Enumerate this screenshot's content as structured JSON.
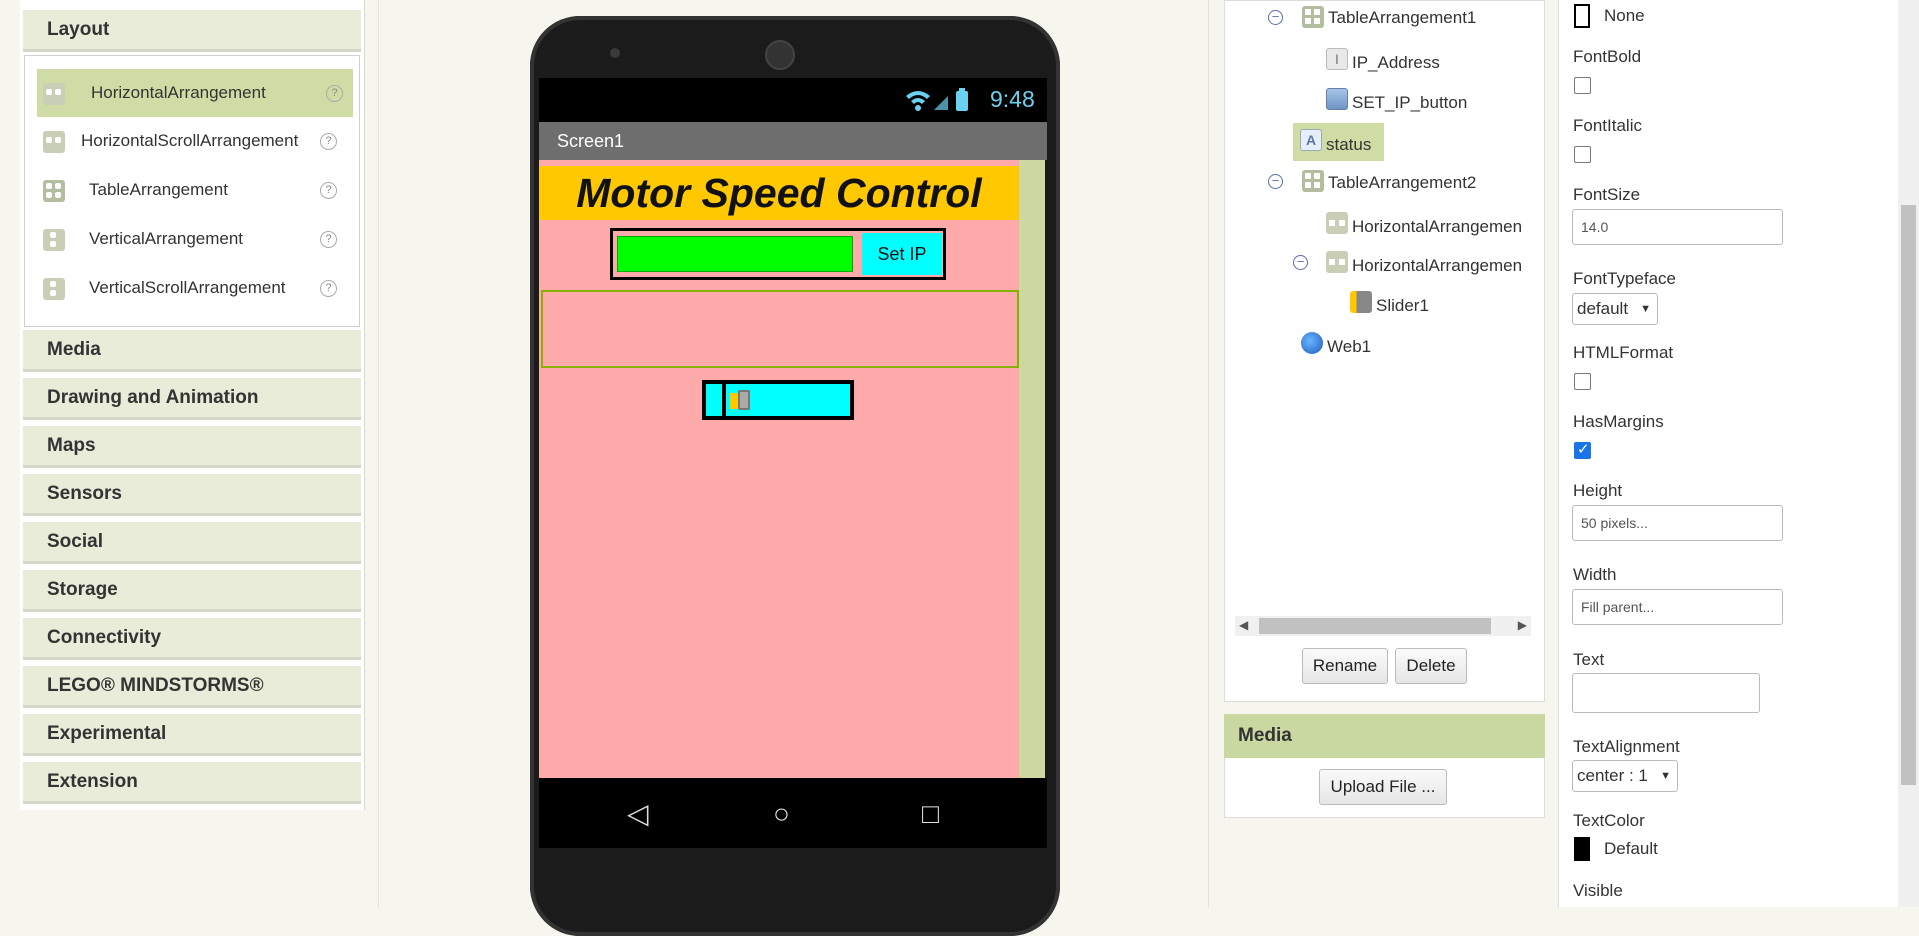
{
  "palette": {
    "layout_header": "Layout",
    "layout_items": [
      {
        "label": "HorizontalArrangement",
        "help": "?"
      },
      {
        "label": "HorizontalScrollArrangement",
        "help": "?"
      },
      {
        "label": "TableArrangement",
        "help": "?"
      },
      {
        "label": "VerticalArrangement",
        "help": "?"
      },
      {
        "label": "VerticalScrollArrangement",
        "help": "?"
      }
    ],
    "categories": [
      "Media",
      "Drawing and Animation",
      "Maps",
      "Sensors",
      "Social",
      "Storage",
      "Connectivity",
      "LEGO® MINDSTORMS®",
      "Experimental",
      "Extension"
    ]
  },
  "phone": {
    "clock": "9:48",
    "screen_title": "Screen1",
    "app_title": "Motor Speed Control",
    "set_ip_label": "Set IP",
    "nav": {
      "back": "◁",
      "home": "○",
      "recent": "□"
    }
  },
  "components": {
    "tree": [
      {
        "label": "TableArrangement1",
        "icon": "table-arrangement-icon"
      },
      {
        "label": "IP_Address",
        "icon": "textbox-icon"
      },
      {
        "label": "SET_IP_button",
        "icon": "button-icon"
      },
      {
        "label": "status",
        "icon": "label-icon"
      },
      {
        "label": "TableArrangement2",
        "icon": "table-arrangement-icon"
      },
      {
        "label": "HorizontalArrangemen",
        "icon": "horizontal-arrangement-icon"
      },
      {
        "label": "HorizontalArrangemen",
        "icon": "horizontal-arrangement-icon"
      },
      {
        "label": "Slider1",
        "icon": "slider-icon"
      },
      {
        "label": "Web1",
        "icon": "web-icon"
      }
    ],
    "collapse_glyph": "−",
    "rename_label": "Rename",
    "delete_label": "Delete"
  },
  "media": {
    "header": "Media",
    "upload_label": "Upload File ..."
  },
  "properties": {
    "none_label": "None",
    "font_bold": "FontBold",
    "font_italic": "FontItalic",
    "font_size": "FontSize",
    "font_size_value": "14.0",
    "font_typeface": "FontTypeface",
    "font_typeface_value": "default",
    "html_format": "HTMLFormat",
    "has_margins": "HasMargins",
    "height": "Height",
    "height_value": "50 pixels...",
    "width": "Width",
    "width_value": "Fill parent...",
    "text": "Text",
    "text_alignment": "TextAlignment",
    "text_alignment_value": "center : 1",
    "text_color": "TextColor",
    "text_color_value": "Default",
    "visible": "Visible"
  },
  "colors": {
    "selected": "#d0dca6",
    "app_title_bg": "#ffc800",
    "screen_bg": "#ffaaaa",
    "ip_input_bg": "#00ff00",
    "set_ip_bg": "#00ffff"
  }
}
